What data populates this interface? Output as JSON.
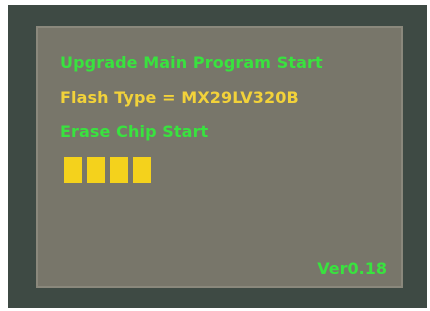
{
  "screen": {
    "line1": "Upgrade Main Program Start",
    "line2": "Flash Type = MX29LV320B",
    "line3": "Erase Chip Start",
    "version": "Ver0.18"
  },
  "progress": {
    "visible_blocks": 4
  },
  "colors": {
    "frame": "#3e4a44",
    "screen_background": "#78766a",
    "status_text": "#39e23f",
    "info_text": "#f2d23a",
    "progress_block": "#f4d21c"
  }
}
